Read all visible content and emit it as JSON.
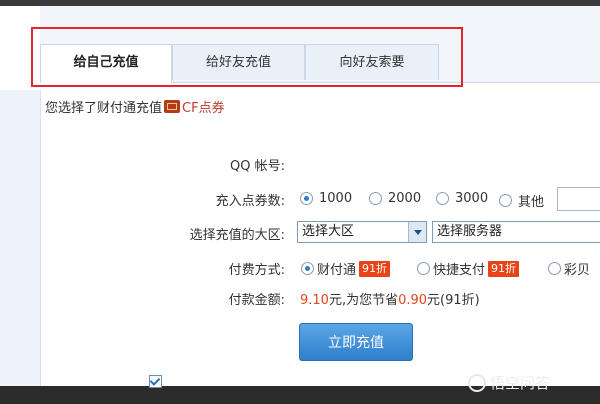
{
  "tabs": [
    {
      "label": "给自己充值",
      "active": true
    },
    {
      "label": "给好友充值",
      "active": false
    },
    {
      "label": "向好友索要",
      "active": false
    }
  ],
  "info": {
    "prefix": "您选择了财付通充值",
    "product": "CF点券"
  },
  "form": {
    "qq_label": "QQ 帐号:",
    "points_label": "充入点券数:",
    "points_options": [
      "1000",
      "2000",
      "3000",
      "其他"
    ],
    "points_selected": "1000",
    "region_label": "选择充值的大区:",
    "region_value": "选择大区",
    "server_value": "选择服务器",
    "pay_label": "付费方式:",
    "pay_options": [
      {
        "label": "财付通",
        "badge": "91折",
        "checked": true
      },
      {
        "label": "快捷支付",
        "badge": "91折",
        "checked": false
      },
      {
        "label": "彩贝",
        "checked": false
      }
    ],
    "amount_label": "付款金额:",
    "amount_value": "9.10",
    "amount_unit": "元,为您节省",
    "saved_value": "0.90",
    "saved_suffix": "元(91折)"
  },
  "submit_label": "立即充值",
  "watermark": "悟空问答",
  "colors": {
    "accent": "#2f7fcc",
    "highlight": "#e8441a",
    "annotation": "#e2262f"
  }
}
